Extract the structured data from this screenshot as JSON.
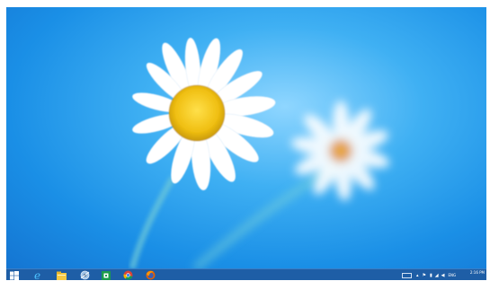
{
  "desktop": {
    "wallpaper": "daisies-on-blue",
    "colors": {
      "sky_light": "#8fd6ff",
      "sky": "#1a8fe6",
      "petal": "#ffffff",
      "center": "#f2c318",
      "center_far": "#f29a2e"
    }
  },
  "taskbar": {
    "background": "#1e5ea6",
    "apps": [
      {
        "name": "start-button",
        "icon": "windows-logo-icon"
      },
      {
        "name": "internet-explorer-button",
        "icon": "internet-explorer-icon"
      },
      {
        "name": "file-explorer-button",
        "icon": "folder-icon"
      },
      {
        "name": "app-button-settings",
        "icon": "gear-globe-icon"
      },
      {
        "name": "app-button-green",
        "icon": "green-app-icon"
      },
      {
        "name": "chrome-button",
        "icon": "chrome-icon"
      },
      {
        "name": "firefox-button",
        "icon": "firefox-icon"
      }
    ],
    "tray": {
      "keyboard_label": "",
      "language": "ENG",
      "time": "2:16 PM",
      "date": "6/27/2016"
    }
  }
}
